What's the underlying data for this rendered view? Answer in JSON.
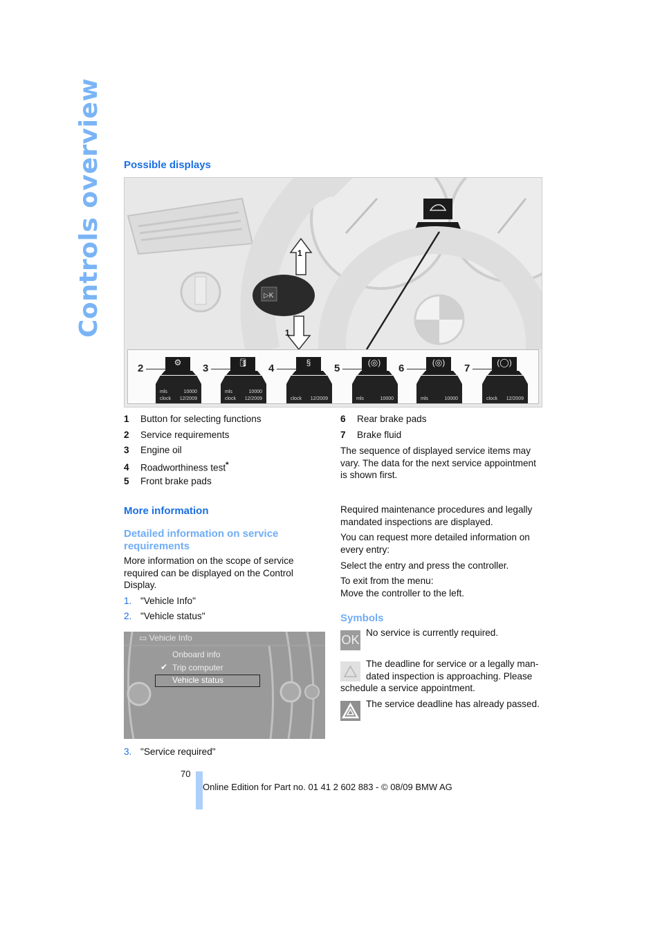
{
  "side_title": "Controls overview",
  "possible_displays": {
    "heading": "Possible displays",
    "figure": {
      "callout_up": "1",
      "callout_down": "1",
      "displays": [
        {
          "number": "2",
          "icon": "car-on-lift-icon",
          "glyph": "⚙",
          "line1_label": "mls",
          "line1_value": "10000",
          "line2_label": "clock",
          "line2_value": "12/2009"
        },
        {
          "number": "3",
          "icon": "oil-can-icon",
          "glyph": "🛢",
          "line1_label": "mls",
          "line1_value": "10000",
          "line2_label": "clock",
          "line2_value": "12/2009"
        },
        {
          "number": "4",
          "icon": "section-car-icon",
          "glyph": "§",
          "line1_label": "",
          "line1_value": "",
          "line2_label": "clock",
          "line2_value": "12/2009"
        },
        {
          "number": "5",
          "icon": "front-brake-icon",
          "glyph": "(◎)",
          "line1_label": "",
          "line1_value": "",
          "line2_label": "mls",
          "line2_value": "10000"
        },
        {
          "number": "6",
          "icon": "rear-brake-icon",
          "glyph": "(◎)",
          "line1_label": "",
          "line1_value": "",
          "line2_label": "mls",
          "line2_value": "10000"
        },
        {
          "number": "7",
          "icon": "brake-fluid-icon",
          "glyph": "(◯)",
          "line1_label": "",
          "line1_value": "",
          "line2_label": "clock",
          "line2_value": "12/2009"
        }
      ]
    },
    "legend_left": [
      {
        "n": "1",
        "text": "Button for selecting functions"
      },
      {
        "n": "2",
        "text": "Service requirements"
      },
      {
        "n": "3",
        "text": "Engine oil"
      },
      {
        "n": "4",
        "text": "Roadworthiness test",
        "asterisk": "*"
      },
      {
        "n": "5",
        "text": "Front brake pads"
      }
    ],
    "legend_right": [
      {
        "n": "6",
        "text": "Rear brake pads"
      },
      {
        "n": "7",
        "text": "Brake fluid"
      }
    ],
    "note": "The sequence of displayed service items may vary. The data for the next service appointment is shown first."
  },
  "more_info": {
    "heading": "More information",
    "subheading": "Detailed information on service requirements",
    "intro": "More information on the scope of service required can be displayed on the Control Display.",
    "steps": [
      {
        "n": "1.",
        "text": "\"Vehicle Info\""
      },
      {
        "n": "2.",
        "text": "\"Vehicle status\""
      },
      {
        "n": "3.",
        "text": "\"Service required\""
      }
    ],
    "screen": {
      "title": "Vehicle Info",
      "items": [
        "Onboard info",
        "Trip computer",
        "Vehicle status"
      ],
      "checked_item": "Trip computer",
      "selected_item": "Vehicle status",
      "check_mark": "✔"
    }
  },
  "right_column": {
    "p1": "Required maintenance procedures and legally mandated inspections are displayed.",
    "p2": "You can request more detailed information on every entry:",
    "p3": "Select the entry and press the controller.",
    "p4a": "To exit from the menu:",
    "p4b": "Move the controller to the left.",
    "symbols_heading": "Symbols",
    "symbols": [
      {
        "icon": "ok-icon",
        "label": "OK",
        "text": "No service is currently required."
      },
      {
        "icon": "warning-light-icon",
        "text_a": "The deadline for service or a legally man-",
        "text_b": "dated inspection is approaching. Please",
        "text_c": "schedule a service appointment."
      },
      {
        "icon": "warning-dark-icon",
        "text": "The service deadline has already passed."
      }
    ]
  },
  "footer": {
    "page_number": "70",
    "edition": "Online Edition for Part no. 01 41 2 602 883 - © 08/09 BMW AG"
  }
}
